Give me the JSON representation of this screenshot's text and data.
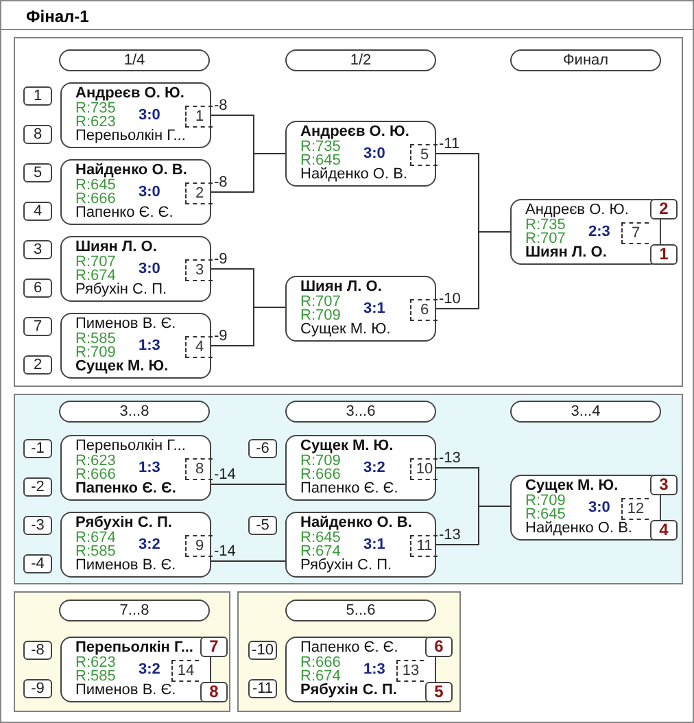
{
  "title": "Фінал-1",
  "panels": [
    {
      "kind": "main",
      "rounds": [
        {
          "label": "1/4"
        },
        {
          "label": "1/2"
        },
        {
          "label": "Финал"
        }
      ],
      "matches": [
        {
          "number": "1",
          "score": "3:0",
          "loser_to": "-8",
          "top": {
            "name": "Андреєв О. Ю.",
            "rating": "R:735",
            "winner": true,
            "seed": "1"
          },
          "bottom": {
            "name": "Перепьолкін Г...",
            "rating": "R:623",
            "winner": false,
            "seed": "8"
          }
        },
        {
          "number": "2",
          "score": "3:0",
          "loser_to": "-8",
          "top": {
            "name": "Найденко О. В.",
            "rating": "R:645",
            "winner": true,
            "seed": "5"
          },
          "bottom": {
            "name": "Папенко Є. Є.",
            "rating": "R:666",
            "winner": false,
            "seed": "4"
          }
        },
        {
          "number": "3",
          "score": "3:0",
          "loser_to": "-9",
          "top": {
            "name": "Шиян Л. О.",
            "rating": "R:707",
            "winner": true,
            "seed": "3"
          },
          "bottom": {
            "name": "Рябухін С. П.",
            "rating": "R:674",
            "winner": false,
            "seed": "6"
          }
        },
        {
          "number": "4",
          "score": "1:3",
          "loser_to": "-9",
          "top": {
            "name": "Пименов В. Є.",
            "rating": "R:585",
            "winner": false,
            "seed": "7"
          },
          "bottom": {
            "name": "Сущек М. Ю.",
            "rating": "R:709",
            "winner": true,
            "seed": "2"
          }
        },
        {
          "number": "5",
          "score": "3:0",
          "loser_to": "-11",
          "top": {
            "name": "Андреєв О. Ю.",
            "rating": "R:735",
            "winner": true
          },
          "bottom": {
            "name": "Найденко О. В.",
            "rating": "R:645",
            "winner": false
          }
        },
        {
          "number": "6",
          "score": "3:1",
          "loser_to": "-10",
          "top": {
            "name": "Шиян Л. О.",
            "rating": "R:707",
            "winner": true
          },
          "bottom": {
            "name": "Сущек М. Ю.",
            "rating": "R:709",
            "winner": false
          }
        },
        {
          "number": "7",
          "score": "2:3",
          "top": {
            "name": "Андреєв О. Ю.",
            "rating": "R:735",
            "winner": false,
            "place": "2"
          },
          "bottom": {
            "name": "Шиян Л. О.",
            "rating": "R:707",
            "winner": true,
            "place": "1"
          }
        }
      ]
    },
    {
      "kind": "consolation",
      "rounds": [
        {
          "label": "3...8"
        },
        {
          "label": "3...6"
        },
        {
          "label": "3...4"
        }
      ],
      "matches": [
        {
          "number": "8",
          "score": "1:3",
          "loser_to": "-14",
          "top": {
            "name": "Перепьолкін Г...",
            "rating": "R:623",
            "winner": false,
            "seed": "-1"
          },
          "bottom": {
            "name": "Папенко Є. Є.",
            "rating": "R:666",
            "winner": true,
            "seed": "-2"
          }
        },
        {
          "number": "9",
          "score": "3:2",
          "loser_to": "-14",
          "top": {
            "name": "Рябухін С. П.",
            "rating": "R:674",
            "winner": true,
            "seed": "-3"
          },
          "bottom": {
            "name": "Пименов В. Є.",
            "rating": "R:585",
            "winner": false,
            "seed": "-4"
          }
        },
        {
          "number": "10",
          "score": "3:2",
          "loser_to": "-13",
          "top": {
            "name": "Сущек М. Ю.",
            "rating": "R:709",
            "winner": true,
            "seed": "-6"
          },
          "bottom": {
            "name": "Папенко Є. Є.",
            "rating": "R:666",
            "winner": false
          }
        },
        {
          "number": "11",
          "score": "3:1",
          "loser_to": "-13",
          "top": {
            "name": "Найденко О. В.",
            "rating": "R:645",
            "winner": true,
            "seed": "-5"
          },
          "bottom": {
            "name": "Рябухін С. П.",
            "rating": "R:674",
            "winner": false
          }
        },
        {
          "number": "12",
          "score": "3:0",
          "top": {
            "name": "Сущек М. Ю.",
            "rating": "R:709",
            "winner": true,
            "place": "3"
          },
          "bottom": {
            "name": "Найденко О. В.",
            "rating": "R:645",
            "winner": false,
            "place": "4"
          }
        }
      ]
    },
    {
      "kind": "placement",
      "rounds": [
        {
          "label": "7...8"
        }
      ],
      "matches": [
        {
          "number": "14",
          "score": "3:2",
          "top": {
            "name": "Перепьолкін Г...",
            "rating": "R:623",
            "winner": true,
            "seed": "-8",
            "place": "7"
          },
          "bottom": {
            "name": "Пименов В. Є.",
            "rating": "R:585",
            "winner": false,
            "seed": "-9",
            "place": "8"
          }
        }
      ]
    },
    {
      "kind": "placement",
      "rounds": [
        {
          "label": "5...6"
        }
      ],
      "matches": [
        {
          "number": "13",
          "score": "1:3",
          "top": {
            "name": "Папенко Є. Є.",
            "rating": "R:666",
            "winner": false,
            "seed": "-10",
            "place": "6"
          },
          "bottom": {
            "name": "Рябухін С. П.",
            "rating": "R:674",
            "winner": true,
            "seed": "-11",
            "place": "5"
          }
        }
      ]
    }
  ]
}
